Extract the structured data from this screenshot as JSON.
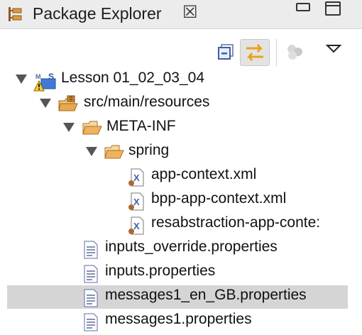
{
  "view": {
    "title": "Package Explorer",
    "close_glyph": "☒",
    "tab_icon": "package-explorer-icon"
  },
  "toolbar": {
    "collapse_all": "collapse-all-icon",
    "link_with_editor": "link-with-editor-icon",
    "focus": "focus-icon",
    "view_menu": "view-menu-icon"
  },
  "tree": {
    "project": "Lesson 01_02_03_04",
    "source_folder": "src/main/resources",
    "meta_inf": "META-INF",
    "spring": "spring",
    "files_spring": [
      "app-context.xml",
      "bpp-app-context.xml",
      "resabstraction-app-conte:"
    ],
    "files_resources": [
      "inputs_override.properties",
      "inputs.properties",
      "messages1_en_GB.properties",
      "messages1.properties"
    ],
    "selected": "messages1_en_GB.properties"
  },
  "colors": {
    "selection": "#d5d5d5",
    "folder": "#e3a24a",
    "xml_blue": "#3c63a8"
  }
}
